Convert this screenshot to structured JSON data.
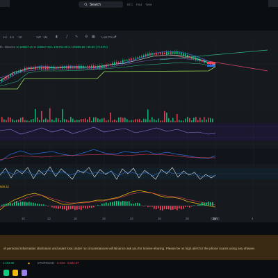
{
  "topbar": {
    "search_label": "Search",
    "tags": [
      "BTC",
      "FDU",
      "TWN"
    ]
  },
  "toolbar": {
    "timeframes": [
      "1H",
      "4H",
      "1D",
      "1W",
      "1M"
    ],
    "chart_type_label": "Last Price"
  },
  "legend": {
    "symbol": "th · Binance",
    "ohlc": "O 105827.40 H 105927.90 L 105761.90 C 105865.90",
    "change": "+38.50 (+0.04%)"
  },
  "macd_value": "569.32",
  "x_axis": {
    "labels": [
      "10",
      "13",
      "16",
      "19",
      "22",
      "25",
      "28",
      "Jun",
      "4"
    ],
    "active_label": "Jun"
  },
  "warning": {
    "text": "of personal information disclosure and asset loss.Under no circumstances will Binance ask you for screen-sharing. Please be on high alert for the phone scams using any oftware."
  },
  "ticker": {
    "prev_change": "1.113.38",
    "symbol": "ETH/FDUSD",
    "change": "2.41%",
    "price": "2,621.37"
  },
  "colors": {
    "up": "#0ecb81",
    "down": "#f6465d",
    "accent": "#f0b90b",
    "panel": "#161a1e",
    "warning_bg": "#3b2a13"
  }
}
